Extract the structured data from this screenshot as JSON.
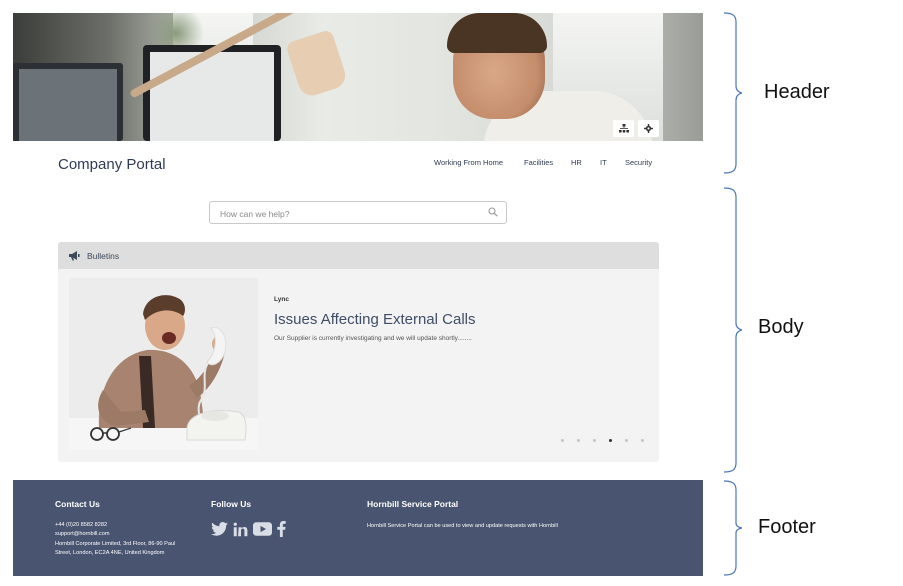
{
  "header": {
    "brand": "Company Portal",
    "nav_items": [
      "Working From Home",
      "Facilities",
      "HR",
      "IT",
      "Security"
    ],
    "banner_buttons": [
      "sitemap-icon",
      "gear-icon"
    ]
  },
  "search": {
    "placeholder": "How can we help?",
    "icon": "search-icon"
  },
  "bulletins": {
    "title": "Bulletins",
    "icon": "megaphone-icon",
    "slide": {
      "category": "Lync",
      "title": "Issues Affecting External Calls",
      "description": "Our Supplier is currently investigating and we will update shortly........"
    },
    "slide_count": 6,
    "active_slide": 4
  },
  "footer": {
    "contact": {
      "heading": "Contact Us",
      "phone": "+44 (0)20 8582 8282",
      "email": "support@hornbill.com",
      "address_line1": "Hornbill Corporate Limited, 3rd Floor, 86-90 Paul",
      "address_line2": "Street, London, EC2A 4NE, United Kingdom"
    },
    "follow": {
      "heading": "Follow Us",
      "icons": [
        "twitter-icon",
        "linkedin-icon",
        "youtube-icon",
        "facebook-icon"
      ]
    },
    "portal": {
      "heading": "Hornbill Service Portal",
      "text": "Hornbill Service Portal can be used to view and update requests with Hornbill"
    }
  },
  "annotations": [
    "Header",
    "Body",
    "Footer"
  ],
  "colors": {
    "brand_text": "#2f3b55",
    "footer_bg": "#485470",
    "card_bg": "#f3f3f3",
    "card_header_bg": "#dedede",
    "bracket": "#4a78b5"
  }
}
